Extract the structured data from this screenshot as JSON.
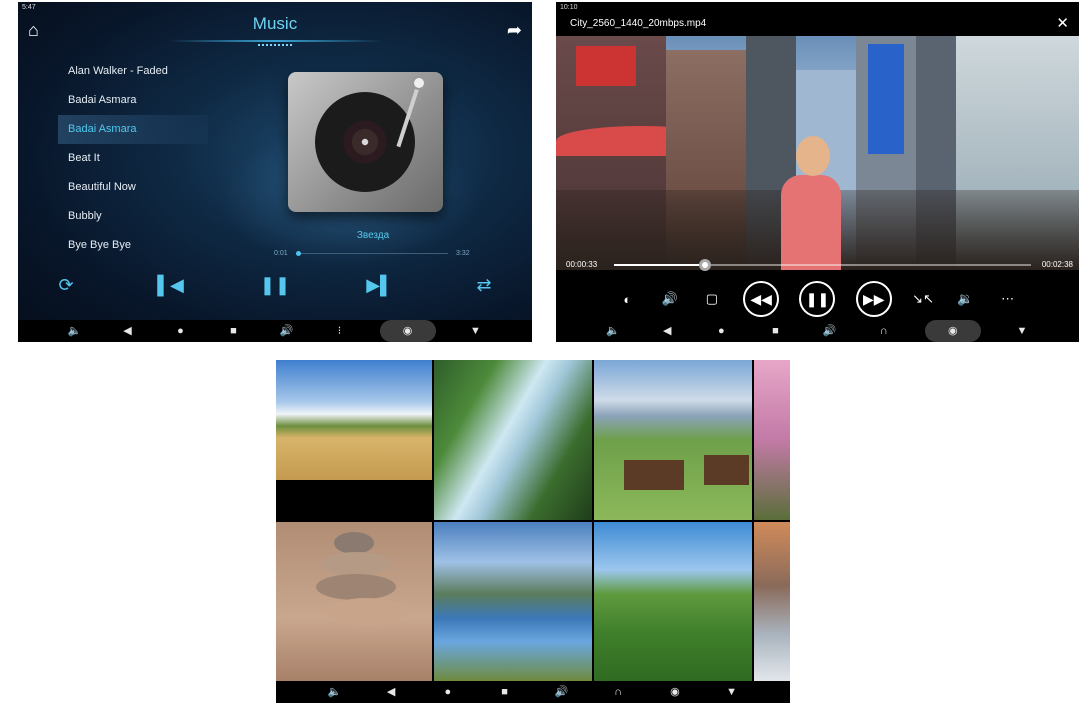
{
  "music": {
    "status_time": "5:47",
    "title": "Music",
    "songs": [
      "Alan Walker - Faded",
      "Badai Asmara",
      "Badai Asmara",
      "Beat It",
      "Beautiful Now",
      "Bubbly",
      "Bye Bye Bye"
    ],
    "active_index": 2,
    "now_playing": "Звезда",
    "time_current": "0:01",
    "time_total": "3:32",
    "progress_fraction": 0.01,
    "accent_color": "#51c8ee",
    "icons": {
      "home": "home-icon",
      "share": "share-icon",
      "repeat": "repeat-icon",
      "previous": "previous-icon",
      "pause": "pause-icon",
      "next": "next-icon",
      "shuffle": "shuffle-icon"
    }
  },
  "video": {
    "status_time": "10:10",
    "filename": "City_2560_1440_20mbps.mp4",
    "time_current": "00:00:33",
    "time_total": "00:02:38",
    "progress_fraction": 0.21,
    "icons": [
      "brightness-icon",
      "volume-icon",
      "aspect-ratio-icon",
      "rewind-icon",
      "pause-icon",
      "fast-forward-icon",
      "shrink-icon",
      "audio-track-icon",
      "more-icon"
    ]
  },
  "gallery": {
    "tiles": [
      "wheat-field-photo",
      "waterfall-photo",
      "alpine-cabins-photo",
      "cherry-blossom-photo",
      "stacked-stones-photo",
      "mountain-lake-photo",
      "green-hills-photo",
      "cliff-photo"
    ]
  },
  "navbar": {
    "icons": [
      "volume-down-icon",
      "back-icon",
      "home-icon",
      "recents-icon",
      "volume-up-icon",
      "headset-icon",
      "screenshot-icon",
      "hide-icon"
    ]
  }
}
